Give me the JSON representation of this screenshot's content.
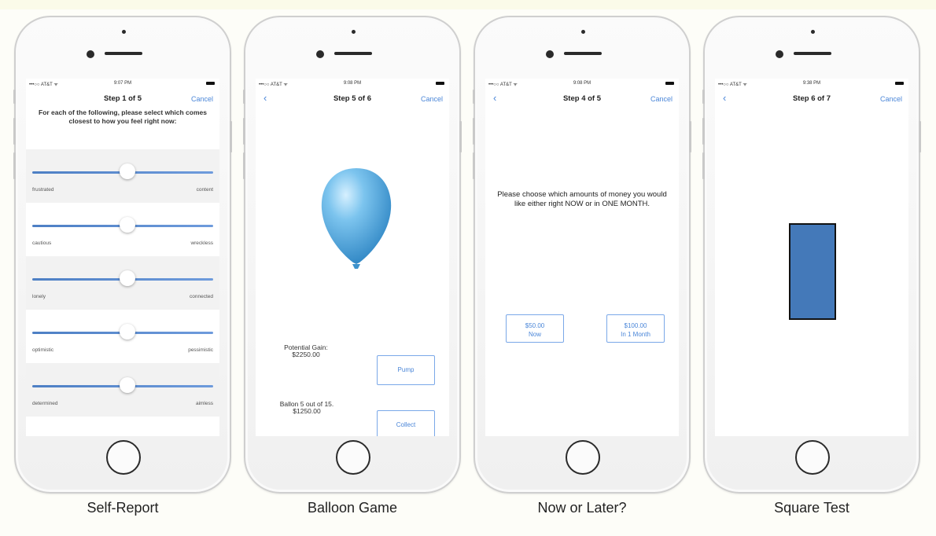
{
  "phones": [
    {
      "status": {
        "carrier": "•••○○ AT&T ᯤ",
        "time": "9:07 PM"
      },
      "nav": {
        "title": "Step 1 of 5",
        "cancel": "Cancel"
      },
      "prompt": "For each of the following, please select which comes closest to how you feel right now:",
      "sliders": [
        {
          "left": "frustrated",
          "right": "content",
          "value": 0.5
        },
        {
          "left": "cautious",
          "right": "wreckless",
          "value": 0.5
        },
        {
          "left": "lonely",
          "right": "connected",
          "value": 0.5
        },
        {
          "left": "optimistic",
          "right": "pessimistic",
          "value": 0.5
        },
        {
          "left": "determined",
          "right": "aimless",
          "value": 0.5
        }
      ],
      "caption": "Self-Report"
    },
    {
      "status": {
        "carrier": "•••○○ AT&T ᯤ",
        "time": "9:08 PM"
      },
      "nav": {
        "back": "‹",
        "title": "Step 5 of 6",
        "cancel": "Cancel"
      },
      "gain_label": "Potential Gain:",
      "gain_value": "$2250.00",
      "pump_label": "Pump",
      "ballon_label": "Ballon 5 out of 15.",
      "ballon_value": "$1250.00",
      "collect_label": "Collect",
      "caption": "Balloon Game"
    },
    {
      "status": {
        "carrier": "•••○○ AT&T ᯤ",
        "time": "9:08 PM"
      },
      "nav": {
        "back": "‹",
        "title": "Step 4 of 5",
        "cancel": "Cancel"
      },
      "prompt": "Please choose which amounts of money you would like either right NOW or in ONE MONTH.",
      "option_now": {
        "amount": "$50.00",
        "when": "Now"
      },
      "option_later": {
        "amount": "$100.00",
        "when": "In 1 Month"
      },
      "caption": "Now or Later?"
    },
    {
      "status": {
        "carrier": "•••○○ AT&T ᯤ",
        "time": "9:38 PM"
      },
      "nav": {
        "back": "‹",
        "title": "Step 6 of 7",
        "cancel": "Cancel"
      },
      "caption": "Square Test"
    }
  ],
  "colors": {
    "accent": "#4a86d8",
    "slider": "#5a8bd0",
    "square": "#4479b9",
    "balloon": "#5aaee0"
  }
}
